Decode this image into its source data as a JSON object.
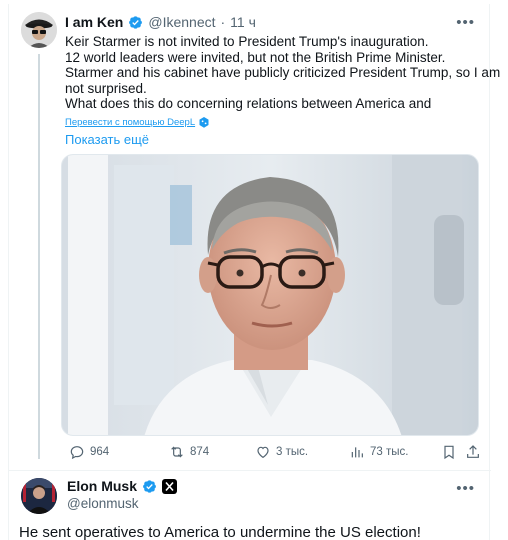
{
  "tweet": {
    "author_name": "I am Ken",
    "handle": "@Ikennect",
    "separator": "·",
    "time": "11 ч",
    "more": "•••",
    "text_lines": [
      "Keir Starmer is not invited to President Trump's inauguration.",
      "12 world leaders were invited, but not the British Prime Minister.",
      "Starmer and his cabinet have publicly criticized President Trump, so I am",
      "not surprised.",
      "What does this do concerning relations between America and"
    ],
    "translate_label": "Перевести с помощью DeepL",
    "show_more": "Показать ещё",
    "stats": {
      "replies": "964",
      "reposts": "874",
      "likes": "3 тыс.",
      "views": "73 тыс."
    }
  },
  "reply": {
    "author_name": "Elon Musk",
    "handle": "@elonmusk",
    "more": "•••",
    "text": "He sent operatives to America to undermine the US election!"
  },
  "colors": {
    "accent": "#1d9bf0",
    "muted": "#536471",
    "text": "#0f1419"
  }
}
